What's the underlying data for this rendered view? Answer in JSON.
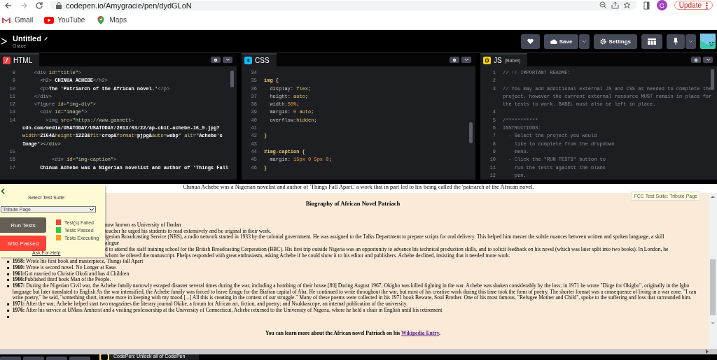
{
  "browser": {
    "url": "codepen.io/Amygracie/pen/dydGLoN",
    "profile_initial": "G",
    "update_label": "Update",
    "bookmarks": [
      {
        "kind": "mail",
        "label": "Gmail"
      },
      {
        "kind": "video",
        "label": "YouTube"
      },
      {
        "kind": "map",
        "label": "Maps"
      }
    ]
  },
  "pen": {
    "title": "Untitled",
    "author": "Grace",
    "buttons": [
      {
        "kind": "heart"
      },
      {
        "kind": "save",
        "label": "Save"
      },
      {
        "kind": "settings",
        "label": "Settings"
      },
      {
        "kind": "layout"
      },
      {
        "kind": "pin"
      }
    ]
  },
  "editors": [
    {
      "kind": "html",
      "title": "HTML",
      "lines": [
        {
          "number": "8",
          "text": "    <div id=\"title\">"
        },
        {
          "number": "9",
          "text": "      <h2> CHINUA ACHEBE</h2>"
        },
        {
          "number": "10",
          "text": "      <p>The 'Patriarch of the African novel.'</p>"
        },
        {
          "number": "11",
          "text": "    </div>"
        },
        {
          "number": "12",
          "text": "    <figure id=\"img-div\">"
        },
        {
          "number": "13",
          "text": "      <div id=\"image\">"
        },
        {
          "number": "14",
          "text": "        <img src=\"https://www.gannett-"
        },
        {
          "text": "cdn.com/media/USATODAY/USATODAY/2013/03/22/ap-obit-achebe-16_9.jpg?"
        },
        {
          "text": "width=2164&height=1223&fit=crop&format=pjpg&auto=webp\" alt=\"Achebe's"
        },
        {
          "text": "Image\"></div>"
        },
        {
          "number": "15"
        },
        {
          "number": "16",
          "text": "          <div id=\"img-caption\">"
        },
        {
          "number": "17",
          "text": "      Chinua Achebe was a Nigerian novelist and author of 'Things Fall"
        }
      ]
    },
    {
      "kind": "css",
      "title": "CSS",
      "lines": [
        {
          "number": "34"
        },
        {
          "number": "35",
          "text": "img {"
        },
        {
          "number": "36",
          "text": "  display: flex;"
        },
        {
          "number": "37",
          "text": "  height: auto;"
        },
        {
          "number": "38",
          "text": "  width:50%;"
        },
        {
          "number": "39",
          "text": "  margin: 0 auto;"
        },
        {
          "number": "40",
          "text": "  overflow:hidden;"
        },
        {
          "number": "41"
        },
        {
          "number": "42",
          "text": "}"
        },
        {
          "number": "43"
        },
        {
          "number": "44",
          "text": "#img-caption {"
        },
        {
          "number": "45",
          "text": "  margin: 15px 0 5px 0;"
        },
        {
          "number": "46",
          "text": "}"
        }
      ]
    },
    {
      "kind": "js",
      "title": "JS",
      "subtitle": "(Babel)",
      "lines": [
        {
          "number": "1",
          "text": "// !! IMPORTANT README:"
        },
        {
          "number": "2"
        },
        {
          "number": "3",
          "text": "// You may add additional external JS and CSS as needed to complete the"
        },
        {
          "text": "project, however the current external resource MUST remain in place for"
        },
        {
          "text": "the tests to work. BABEL must also be left in place."
        },
        {
          "number": "4"
        },
        {
          "number": "5",
          "text": "/***********"
        },
        {
          "number": "6",
          "text": "INSTRUCTIONS:"
        },
        {
          "number": "7",
          "text": "  - Select the project you would"
        },
        {
          "number": "8",
          "text": "    like to complete from the dropdown"
        },
        {
          "number": "9",
          "text": "    menu."
        },
        {
          "number": "10",
          "text": "  - Click the \"RUN TESTS\" button to"
        },
        {
          "number": "11",
          "text": "    run the tests against the blank"
        },
        {
          "number": "12",
          "text": "    pen."
        }
      ]
    }
  ],
  "preview": {
    "caption": "Chinua Achebe was a Nigerian novelist and author of 'Things Fall Apart,' a work that in part led to his being called the 'patriarch of the African novel.",
    "heading": "Biography of African Novel Patriach",
    "partial_lines": [
      "now known as University of Ibadan",
      "teacher he urged his students to read extensively and be original in their work.",
      "igerian Broadcasting Service (NBS), a radio network started in 1933 by the colonial government. He was assigned to the Talks Department to prepare scripts for oral delivery. This helped him master the subtle nuances between written and spoken language, a skill",
      "alogue",
      "d to attend the staff training school for the British Broadcasting Corporation (BBC). His first trip outside Nigeria was an opportunity to advance his technical production skills, and to solicit feedback on his novel (which was later split into two books). In London, he",
      "whom he offered the manuscript. Phelps responded with great enthusiasm, asking Achebe if he could show it to his editor and publishers. Achebe declined, insisting that it needed more work."
    ],
    "items": [
      {
        "kind": "text",
        "marker": "■",
        "text": "**1958:** Wrote his first book and masterpiece, Things fall Apart"
      },
      {
        "kind": "text",
        "marker": "■",
        "text": "**1960:** Wrote is second novel. No Longer at Ease."
      },
      {
        "kind": "text",
        "marker": "■",
        "text": "**1961:**Got married to Christie Okoli and has 4 Children"
      },
      {
        "kind": "text",
        "marker": "■",
        "text": "**1966:**Published third book Man of the People."
      },
      {
        "kind": "text",
        "marker": "■",
        "text": "**1967:** During the Nigerian Civil war, the Achebe family narrowly escaped disaster several times during the war, including a bombing of their house.[80] During August 1967, Okigbo was killed fighting in the war. Achebe was shaken considerably by the loss; in 1971 he wrote \"Dirge for Okigbo\", originally in the Igbo language but later translated to English As the war intensified, the Achebe family was forced to leave Enugu for the Biafran capital of Aba. He continued to write throughout the war, but most of his creative work during this time took the form of poetry. The shorter format was a consequence of living in a war zone. \"I can write poetry,\" he said, \"something short, intense more in keeping with my mood [...] All this is creating in the context of our struggle.\" Many of these poems were collected in his 1971 book Beware, Soul Brother. One of his most famous, \"Refugee Mother and Child\", spoke to the suffering and loss that surrounded him."
      },
      {
        "kind": "text",
        "marker": "■",
        "text": "**1971:** After the war, Achebe helped start two magazines the literary journal Okike, a forum for African art, fiction, and poetry; and Nsukkascope, an internal publication of the university."
      },
      {
        "kind": "text",
        "marker": "■",
        "text": "**1976:** After his service at UMass Amherst and a visiting professorship at the University of Connecticut, Achebe returned to the University of Nigeria, where he held a chair in English until his retirement"
      },
      {
        "kind": "empty",
        "marker": "■"
      }
    ],
    "footer": {
      "text": "You can learn more about the African novel Patriach on his",
      "link": "Wikipedia Entry",
      "after": "."
    },
    "tooltip": "FCC Test Suite: Tribute Page"
  },
  "test_panel": {
    "label": "Select Test Suite:",
    "suite": "Tribute Page",
    "run_button": "Run Tests",
    "result": "9/10 Passed",
    "help": "Ask For Help",
    "legend": [
      {
        "label": "Test(s) Failed",
        "color": "#ff4136"
      },
      {
        "label": "Tests Passed",
        "color": "#2ecc40"
      },
      {
        "label": "Tests Executing",
        "color": "#ff9f1a"
      }
    ]
  },
  "promo": {
    "text": "CodePen: Unlock all of CodePen"
  }
}
